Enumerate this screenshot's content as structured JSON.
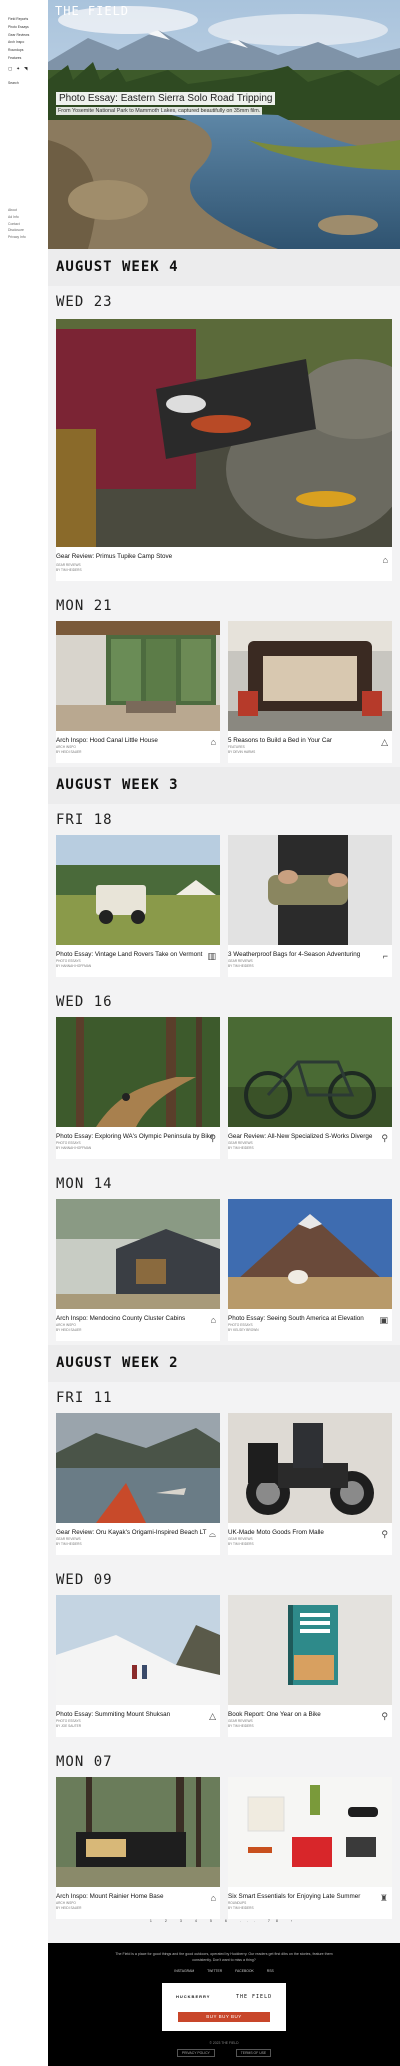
{
  "sidebar": {
    "nav": [
      "Field Reports",
      "Photo Essays",
      "Gear Reviews",
      "Arch Inspo",
      "Roundups",
      "Features"
    ],
    "icons": [
      "instagram-icon",
      "twitter-icon",
      "rss-icon"
    ],
    "search_label": "Search",
    "nav2": [
      "About",
      "Ad Info",
      "Contact",
      "Disclosure",
      "Privacy Info"
    ]
  },
  "hero": {
    "logo": "THE FIELD",
    "title": "Photo Essay: Eastern Sierra Solo Road Tripping",
    "caption": "From Yosemite National Park to Mammoth Lakes, captured beautifully on 35mm film."
  },
  "weeks": [
    {
      "label": "AUGUST WEEK 4"
    },
    {
      "label": "AUGUST WEEK 3"
    },
    {
      "label": "AUGUST WEEK 2"
    }
  ],
  "days": [
    "WED 23",
    "MON 21",
    "FRI 18",
    "WED 16",
    "MON 14",
    "FRI 11",
    "WED 09",
    "MON 07"
  ],
  "cards": [
    {
      "title": "Gear Review: Primus Tupike Camp Stove",
      "category": "GEAR REVIEWS",
      "byline": "BY TIM HEIDERS",
      "icon": "stove-icon"
    },
    {
      "title": "Arch Inspo: Hood Canal Little House",
      "category": "ARCH INSPO",
      "byline": "BY HEIDI SAUER",
      "icon": "house-icon"
    },
    {
      "title": "5 Reasons to Build a Bed in Your Car",
      "category": "FEATURES",
      "byline": "BY DEVIN HARMS",
      "icon": "tent-icon"
    },
    {
      "title": "Photo Essay: Vintage Land Rovers Take on Vermont",
      "category": "PHOTO ESSAYS",
      "byline": "BY HANNAH HOFFMAN",
      "icon": "columns-icon"
    },
    {
      "title": "3 Weatherproof Bags for 4-Season Adventuring",
      "category": "GEAR REVIEWS",
      "byline": "BY TIM HEIDERS",
      "icon": "boot-icon"
    },
    {
      "title": "Photo Essay: Exploring WA's Olympic Peninsula by Bike",
      "category": "PHOTO ESSAYS",
      "byline": "BY HANNAH HOFFMAN",
      "icon": "bike-icon"
    },
    {
      "title": "Gear Review: All-New Specialized S-Works Diverge",
      "category": "GEAR REVIEWS",
      "byline": "BY TIM HEIDERS",
      "icon": "bike-icon"
    },
    {
      "title": "Arch Inspo: Mendocino County Cluster Cabins",
      "category": "ARCH INSPO",
      "byline": "BY HEIDI SAUER",
      "icon": "house-icon"
    },
    {
      "title": "Photo Essay: Seeing South America at Elevation",
      "category": "PHOTO ESSAYS",
      "byline": "BY KELSEY BROWN",
      "icon": "camera-icon"
    },
    {
      "title": "Gear Review: Oru Kayak's Origami-Inspired Beach LT",
      "category": "GEAR REVIEWS",
      "byline": "BY TIM HEIDERS",
      "icon": "kayak-icon"
    },
    {
      "title": "UK-Made Moto Goods From Malle",
      "category": "GEAR REVIEWS",
      "byline": "BY TIM HEIDERS",
      "icon": "moto-icon"
    },
    {
      "title": "Photo Essay: Summiting Mount Shuksan",
      "category": "PHOTO ESSAYS",
      "byline": "BY JOE SAUTER",
      "icon": "mountain-icon"
    },
    {
      "title": "Book Report: One Year on a Bike",
      "category": "GEAR REVIEWS",
      "byline": "BY TIM HEIDERS",
      "icon": "bike-icon"
    },
    {
      "title": "Arch Inspo: Mount Rainier Home Base",
      "category": "ARCH INSPO",
      "byline": "BY HEIDI SAUER",
      "icon": "house-icon"
    },
    {
      "title": "Six Smart Essentials for Enjoying Late Summer",
      "category": "ROUNDUPS",
      "byline": "BY TIM HEIDERS",
      "icon": "lantern-icon"
    }
  ],
  "pagination": [
    "1",
    "2",
    "3",
    "4",
    "5",
    "6",
    "...",
    "78",
    "›"
  ],
  "footer": {
    "text": "The Field is a place for good things and the good outdoors, operated by Huckberry. Our readers get first dibs on the stories, feature them consistently. Don't want to miss a thing?",
    "links": [
      "INSTAGRAM",
      "TWITTER",
      "FACEBOOK",
      "RSS"
    ],
    "promo_brand1": "HUCKBERRY",
    "promo_brand2": "THE FIELD",
    "promo_button": "BUY BUY BUY",
    "copyright": "© 2023 THE FIELD",
    "bottom_links": [
      "PRIVACY POLICY",
      "TERMS OF USE"
    ]
  },
  "colors": {
    "accent": "#c8462a",
    "feed_bg": "#f3f3f4",
    "week_bg": "#ececed",
    "footer_bg": "#000000"
  }
}
